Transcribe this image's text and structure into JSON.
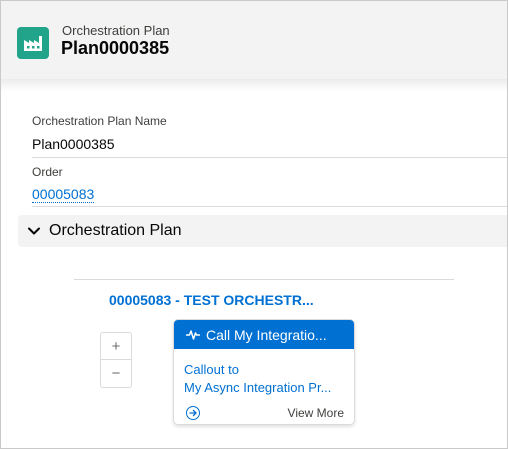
{
  "header": {
    "icon": "orchestration-plan-icon",
    "object_label": "Orchestration Plan",
    "record_name": "Plan0000385",
    "icon_color": "#22a48a"
  },
  "fields": {
    "name_label": "Orchestration Plan Name",
    "name_value": "Plan0000385",
    "order_label": "Order",
    "order_value": "00005083"
  },
  "section": {
    "title": "Orchestration Plan",
    "icon": "chevron-down-icon"
  },
  "plan": {
    "title": "00005083 - TEST ORCHESTR...",
    "zoom_in": "+",
    "zoom_out": "−"
  },
  "step_card": {
    "header_icon": "pulse-icon",
    "header": "Call My Integratio...",
    "body_line1": "Callout to",
    "body_line2": "My Async Integration Pr...",
    "footer_icon": "arrow-circle-icon",
    "view_more": "View More",
    "accent_color": "#0070d2"
  }
}
